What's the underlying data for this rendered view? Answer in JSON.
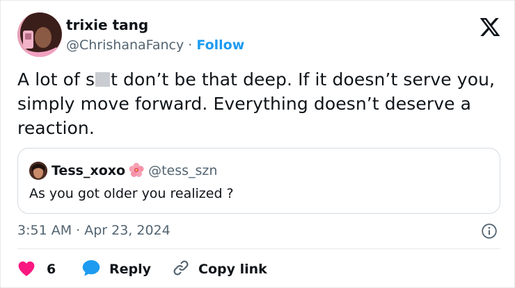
{
  "author": {
    "name": "trixie tang",
    "handle": "@ChrishanaFancy",
    "separator": "·",
    "follow_label": "Follow"
  },
  "tweet": {
    "text_before_censor": "A lot of s",
    "text_after_censor": "t don’t be that deep. If it doesn’t serve you, simply move forward. Everything doesn’t deserve a reaction."
  },
  "quote": {
    "name": "Tess_xoxo",
    "handle": "@tess_szn",
    "text": "As you got older you realized ?"
  },
  "timestamp": "3:51 AM · Apr 23, 2024",
  "actions": {
    "like_count": "6",
    "reply_label": "Reply",
    "copy_label": "Copy link"
  },
  "colors": {
    "accent": "#1d9bf0",
    "heart": "#f91880",
    "secondary_text": "#536471"
  },
  "icons": [
    "x-logo-icon",
    "info-icon",
    "heart-icon",
    "reply-bubble-icon",
    "link-icon",
    "flower-emoji-icon"
  ]
}
